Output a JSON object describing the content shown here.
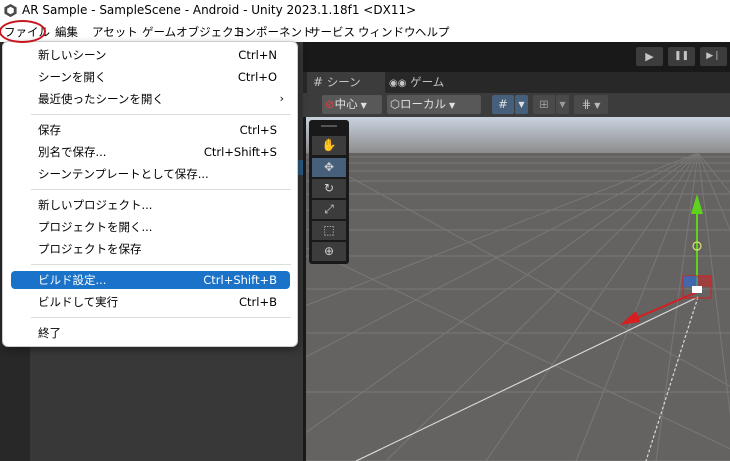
{
  "window": {
    "title": "AR Sample - SampleScene - Android - Unity 2023.1.18f1 <DX11>"
  },
  "menubar": {
    "items": [
      "ファイル",
      "編集",
      "アセット",
      "ゲームオブジェクト",
      "コンポーネント",
      "サービス",
      "ウィンドウ",
      "ヘルプ"
    ]
  },
  "file_menu": {
    "items": [
      {
        "label": "新しいシーン",
        "shortcut": "Ctrl+N"
      },
      {
        "label": "シーンを開く",
        "shortcut": "Ctrl+O"
      },
      {
        "label": "最近使ったシーンを開く",
        "shortcut": "",
        "arrow": "›"
      },
      {
        "label": "保存",
        "shortcut": "Ctrl+S"
      },
      {
        "label": "別名で保存...",
        "shortcut": "Ctrl+Shift+S"
      },
      {
        "label": "シーンテンプレートとして保存...",
        "shortcut": ""
      },
      {
        "label": "新しいプロジェクト...",
        "shortcut": ""
      },
      {
        "label": "プロジェクトを開く...",
        "shortcut": ""
      },
      {
        "label": "プロジェクトを保存",
        "shortcut": ""
      },
      {
        "label": "ビルド設定...",
        "shortcut": "Ctrl+Shift+B",
        "highlighted": true
      },
      {
        "label": "ビルドして実行",
        "shortcut": "Ctrl+B"
      },
      {
        "label": "終了",
        "shortcut": ""
      }
    ]
  },
  "play_controls": {
    "play": "▶",
    "pause": "❚❚",
    "step": "▶❘"
  },
  "tabs": {
    "scene": "シーン",
    "game": "ゲーム"
  },
  "scene_toolbar": {
    "pivot": "中心",
    "space": "ローカル"
  },
  "colors": {
    "menu_highlight": "#1a73c8",
    "annotation_circle": "#c8141c",
    "gizmo_x": "#d81e1e",
    "gizmo_y": "#5ed21c",
    "gizmo_z": "#2d6ae0"
  },
  "icons": {
    "tools": [
      "hand-tool-icon",
      "move-tool-icon",
      "rotate-tool-icon",
      "scale-tool-icon",
      "rect-tool-icon",
      "transform-tool-icon"
    ]
  }
}
